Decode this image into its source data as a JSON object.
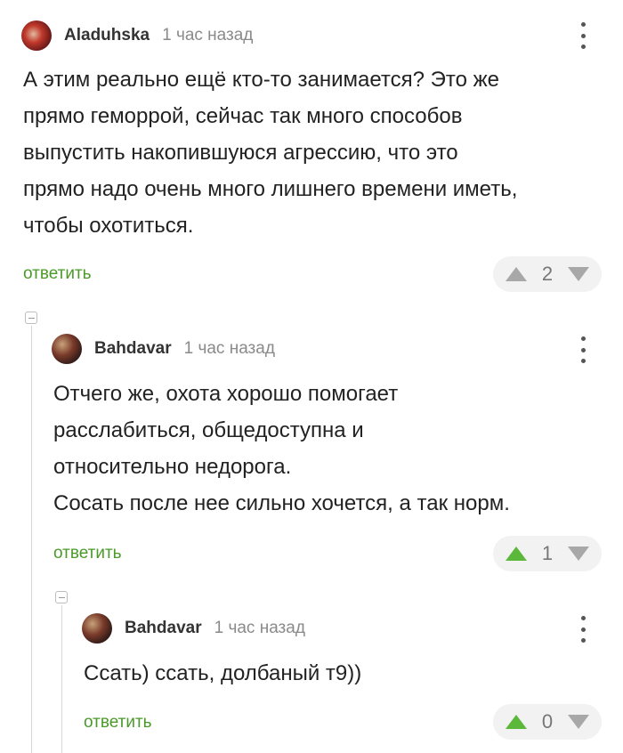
{
  "comments": [
    {
      "author": "Aladuhska",
      "time": "1 час назад",
      "lines": [
        "А этим реально ещё кто-то занимается? Это же",
        "прямо геморрой, сейчас так много способов",
        "выпустить накопившуюся агрессию, что это",
        "прямо надо очень много лишнего времени иметь,",
        "чтобы охотиться."
      ],
      "reply_label": "ответить",
      "rating": "2",
      "upvoted": false
    },
    {
      "author": "Bahdavar",
      "time": "1 час назад",
      "lines": [
        "Отчего же, охота хорошо помогает",
        "расслабиться, общедоступна и",
        "относительно недорога.",
        "Сосать после нее сильно хочется, а так норм."
      ],
      "reply_label": "ответить",
      "rating": "1",
      "upvoted": true
    },
    {
      "author": "Bahdavar",
      "time": "1 час назад",
      "lines": [
        "Ссать) ссать, долбаный т9))"
      ],
      "reply_label": "ответить",
      "rating": "0",
      "upvoted": true
    }
  ],
  "icons": {
    "menu": "more-vertical-icon",
    "upvote": "triangle-up-icon",
    "downvote": "triangle-down-icon",
    "collapse": "collapse-minus-icon"
  },
  "colors": {
    "reply_link": "#4a9a2a",
    "upvote_active": "#5cb83a",
    "vote_inactive": "#a8a8a8",
    "rating_bg": "#f2f2f2"
  }
}
